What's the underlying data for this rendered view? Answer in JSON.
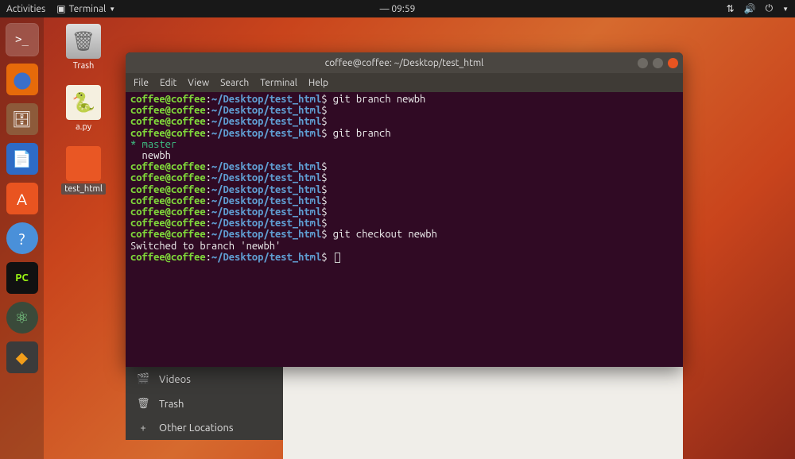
{
  "topbar": {
    "activities": "Activities",
    "app_indicator": "Terminal",
    "clock": "— 09:59"
  },
  "desktop": {
    "trash": "Trash",
    "apy": "a.py",
    "folder": "test_html"
  },
  "files_sidebar": {
    "videos": "Videos",
    "trash": "Trash",
    "other": "Other Locations"
  },
  "terminal": {
    "title": "coffee@coffee: ~/Desktop/test_html",
    "menu": {
      "file": "File",
      "edit": "Edit",
      "view": "View",
      "search": "Search",
      "terminal": "Terminal",
      "help": "Help"
    },
    "prompt": {
      "user": "coffee@coffee",
      "sep": ":",
      "path": "~/Desktop/test_html",
      "sym": "$"
    },
    "lines": {
      "cmd1": " git branch newbh",
      "cmd2": " git branch",
      "branch_master": " master",
      "branch_newbh": "  newbh",
      "cmd3": " git checkout newbh",
      "switched": "Switched to branch 'newbh'"
    }
  },
  "dock": {
    "pycharm": "PC"
  }
}
